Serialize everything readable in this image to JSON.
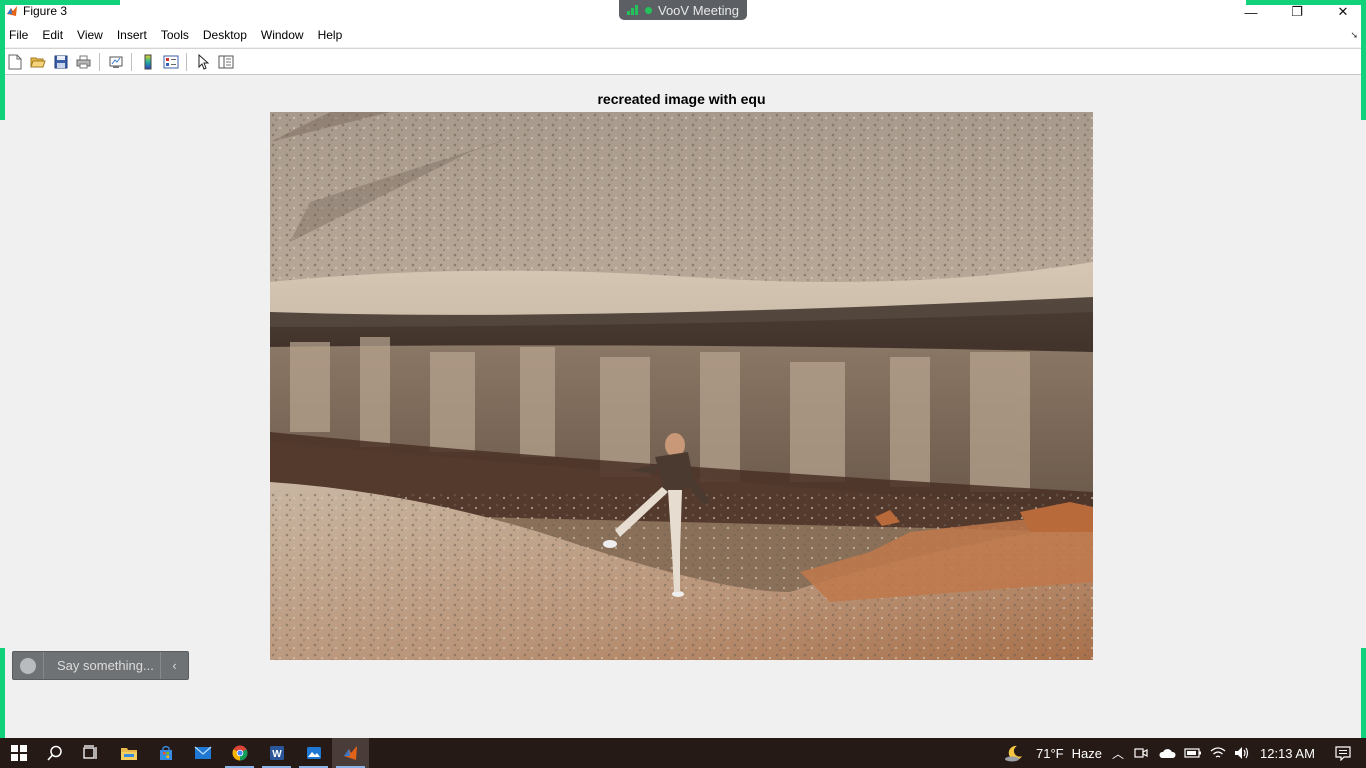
{
  "window": {
    "title": "Figure 3",
    "controls": {
      "minimize": "—",
      "maximize": "❐",
      "close": "✕"
    }
  },
  "meeting": {
    "label": "VooV Meeting"
  },
  "menu": {
    "items": [
      "File",
      "Edit",
      "View",
      "Insert",
      "Tools",
      "Desktop",
      "Window",
      "Help"
    ]
  },
  "toolbar": {
    "buttons": [
      "new-figure-icon",
      "open-file-icon",
      "save-icon",
      "print-icon",
      "link-plot-icon",
      "insert-colorbar-icon",
      "insert-legend-icon",
      "edit-plot-arrow-icon",
      "property-editor-icon"
    ]
  },
  "axes": {
    "title": "recreated image with equ"
  },
  "chat": {
    "placeholder": "Say something...",
    "collapse_glyph": "‹"
  },
  "taskbar": {
    "apps": [
      "start-icon",
      "search-icon",
      "task-view-icon",
      "file-explorer-icon",
      "store-icon",
      "mail-icon",
      "chrome-icon",
      "word-icon",
      "photos-icon",
      "matlab-icon"
    ],
    "weather": {
      "temp": "71°F",
      "condition": "Haze"
    },
    "clock": "12:13 AM"
  },
  "colors": {
    "accent_share": "#11d27a",
    "taskbar": "#261a17"
  }
}
